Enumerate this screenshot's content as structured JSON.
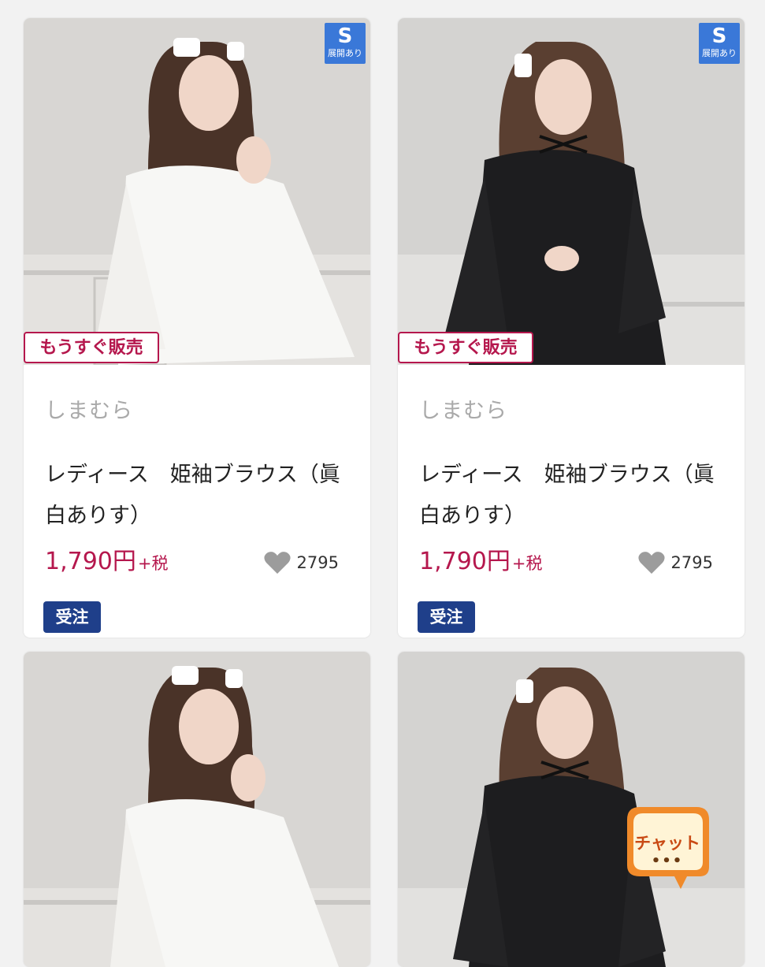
{
  "products": [
    {
      "id_label": "card-1",
      "variant": "white",
      "s_badge": {
        "big": "S",
        "small": "展開あり"
      },
      "status_badge": "もうすぐ販売",
      "brand": "しまむら",
      "title": "レディース　姫袖ブラウス（眞白ありす）",
      "price": "1,790円",
      "tax": "+税",
      "likes": "2795",
      "order_badge": "受注"
    },
    {
      "id_label": "card-2",
      "variant": "black",
      "s_badge": {
        "big": "S",
        "small": "展開あり"
      },
      "status_badge": "もうすぐ販売",
      "brand": "しまむら",
      "title": "レディース　姫袖ブラウス（眞白ありす）",
      "price": "1,790円",
      "tax": "+税",
      "likes": "2795",
      "order_badge": "受注"
    },
    {
      "id_label": "card-3",
      "variant": "white"
    },
    {
      "id_label": "card-4",
      "variant": "black"
    }
  ],
  "chat_button": {
    "label": "チャット",
    "dots": "•••"
  },
  "colors": {
    "accent_price": "#b5174d",
    "order_badge": "#1f3f8a",
    "s_badge": "#3a78d8",
    "chat_bubble": "#f08a2a"
  }
}
